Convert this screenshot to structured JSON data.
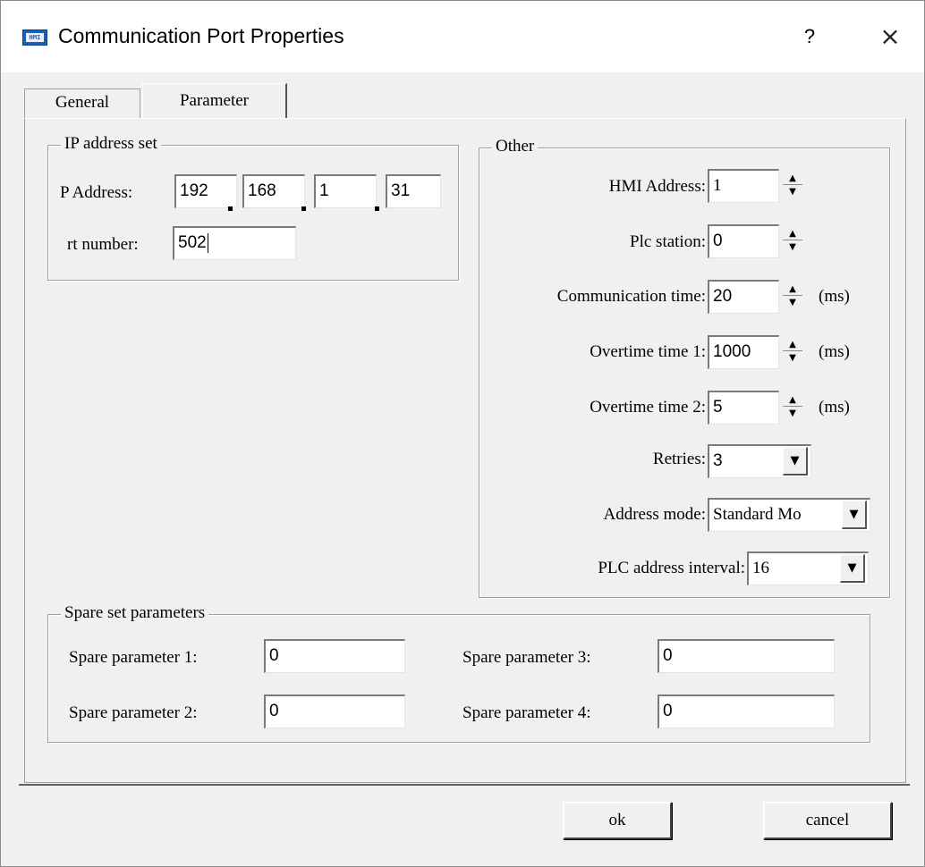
{
  "window": {
    "title": "Communication Port Properties",
    "icon_text": "HMI",
    "help_label": "?",
    "close_label": "×"
  },
  "tabs": [
    {
      "label": "General",
      "active": false
    },
    {
      "label": "Parameter",
      "active": true
    }
  ],
  "ip_group": {
    "title": "IP address set",
    "ip_label": "P Address:",
    "ip_octets": [
      "192",
      "168",
      "1",
      "31"
    ],
    "port_label": "rt number:",
    "port_value": "502"
  },
  "other_group": {
    "title": "Other",
    "hmi_address": {
      "label": "HMI Address:",
      "value": "1"
    },
    "plc_station": {
      "label": "Plc station:",
      "value": "0"
    },
    "comm_time": {
      "label": "Communication time:",
      "value": "20",
      "unit": "(ms)"
    },
    "overtime1": {
      "label": "Overtime time 1:",
      "value": "1000",
      "unit": "(ms)"
    },
    "overtime2": {
      "label": "Overtime time 2:",
      "value": "5",
      "unit": "(ms)"
    },
    "retries": {
      "label": "Retries:",
      "value": "3"
    },
    "address_mode": {
      "label": "Address mode:",
      "value": "Standard Mo"
    },
    "plc_interval": {
      "label": "PLC address interval:",
      "value": "16"
    }
  },
  "spare_group": {
    "title": "Spare set parameters",
    "params": [
      {
        "label": "Spare parameter 1:",
        "value": "0"
      },
      {
        "label": "Spare parameter 2:",
        "value": "0"
      },
      {
        "label": "Spare parameter 3:",
        "value": "0"
      },
      {
        "label": "Spare parameter 4:",
        "value": "0"
      }
    ]
  },
  "buttons": {
    "ok": "ok",
    "cancel": "cancel"
  },
  "icons": {
    "spin_up": "▲",
    "spin_down": "▼",
    "dropdown": "▼"
  }
}
